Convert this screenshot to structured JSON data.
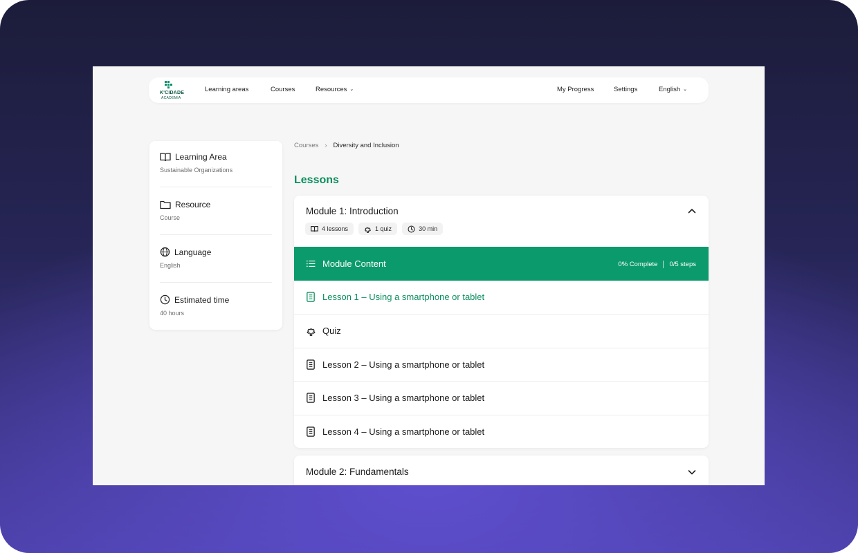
{
  "brand": {
    "name": "K'CIDADE",
    "sub": "ACADEMIA",
    "accent": "#0b9a6b"
  },
  "nav": {
    "learning_areas": "Learning areas",
    "courses": "Courses",
    "resources": "Resources",
    "my_progress": "My Progress",
    "settings": "Settings",
    "language": "English"
  },
  "sidebar": {
    "items": [
      {
        "title": "Learning Area",
        "value": "Sustainable Organizations",
        "icon": "book-icon"
      },
      {
        "title": "Resource",
        "value": "Course",
        "icon": "folder-icon"
      },
      {
        "title": "Language",
        "value": "English",
        "icon": "globe-icon"
      },
      {
        "title": "Estimated time",
        "value": "40 hours",
        "icon": "clock-icon"
      }
    ]
  },
  "breadcrumb": {
    "root": "Courses",
    "current": "Diversity and Inclusion"
  },
  "heading": "Lessons",
  "modules": [
    {
      "title": "Module 1: Introduction",
      "expanded": true,
      "tags": {
        "lessons": "4 lessons",
        "quiz": "1 quiz",
        "time": "30 min"
      },
      "content_bar": {
        "label": "Module Content",
        "complete": "0% Complete",
        "steps": "0/5 steps"
      },
      "rows": [
        {
          "label": "Lesson 1 – Using a smartphone or tablet",
          "icon": "lesson-icon",
          "active": true
        },
        {
          "label": "Quiz",
          "icon": "puzzle-icon",
          "active": false
        },
        {
          "label": "Lesson 2 – Using a smartphone or tablet",
          "icon": "lesson-icon",
          "active": false
        },
        {
          "label": "Lesson 3 – Using a smartphone or tablet",
          "icon": "lesson-icon",
          "active": false
        },
        {
          "label": "Lesson 4 – Using a smartphone or tablet",
          "icon": "lesson-icon",
          "active": false
        }
      ]
    },
    {
      "title": "Module 2: Fundamentals",
      "expanded": false
    }
  ]
}
